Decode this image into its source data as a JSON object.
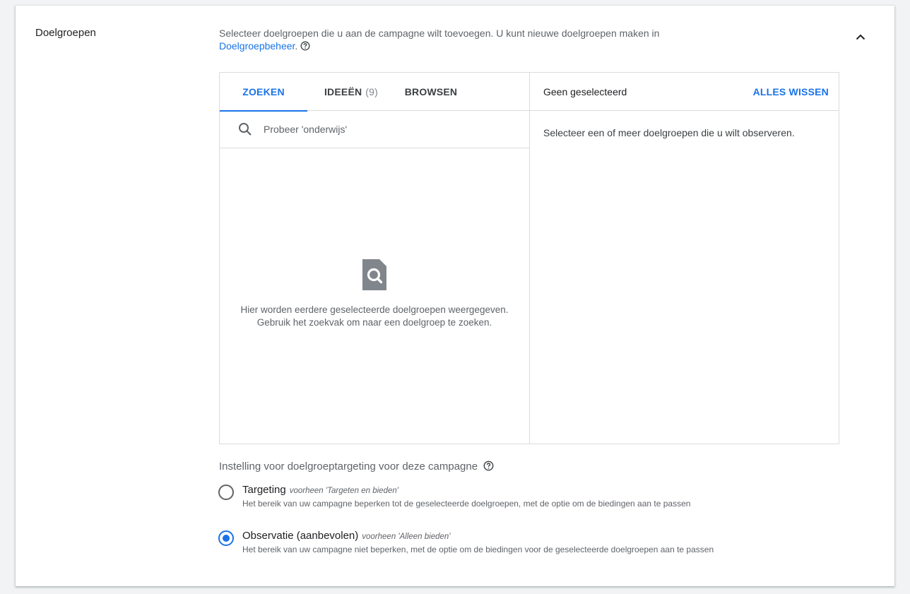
{
  "section": {
    "title": "Doelgroepen",
    "description_text": "Selecteer doelgroepen die u aan de campagne wilt toevoegen. U kunt nieuwe doelgroepen maken in ",
    "description_link": "Doelgroepbeheer",
    "description_end": "."
  },
  "tabs": [
    {
      "label": "ZOEKEN",
      "active": true
    },
    {
      "label": "IDEEËN",
      "count": "(9)",
      "active": false
    },
    {
      "label": "BROWSEN",
      "active": false
    }
  ],
  "search": {
    "placeholder": "Probeer 'onderwijs'"
  },
  "empty_state": {
    "line1": "Hier worden eerdere geselecteerde doelgroepen weergegeven.",
    "line2": "Gebruik het zoekvak om naar een doelgroep te zoeken."
  },
  "selected_panel": {
    "count_text": "Geen geselecteerd",
    "clear_label": "ALLES WISSEN",
    "hint": "Selecteer een of meer doelgroepen die u wilt observeren."
  },
  "targeting_setting": {
    "title": "Instelling voor doelgroeptargeting voor deze campagne",
    "options": [
      {
        "label": "Targeting",
        "sub": "voorheen 'Targeten en bieden'",
        "desc": "Het bereik van uw campagne beperken tot de geselecteerde doelgroepen, met de optie om de biedingen aan te passen",
        "checked": false
      },
      {
        "label": "Observatie (aanbevolen)",
        "sub": "voorheen 'Alleen bieden'",
        "desc": "Het bereik van uw campagne niet beperken, met de optie om de biedingen voor de geselecteerde doelgroepen aan te passen",
        "checked": true
      }
    ]
  },
  "colors": {
    "accent": "#1a73e8",
    "text_secondary": "#5f6368",
    "border": "#dadce0"
  },
  "icons": {
    "collapse": "chevron-up-icon",
    "help": "help-circle-icon",
    "search": "search-icon",
    "empty": "document-search-icon"
  }
}
